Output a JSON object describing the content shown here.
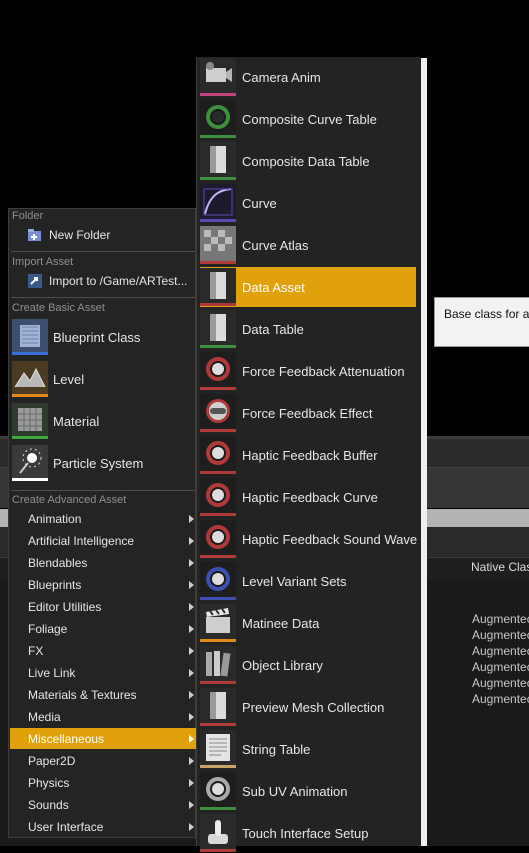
{
  "background": {
    "column_header": "Native Clas",
    "rows": [
      "Augmentec",
      "Augmentec",
      "Augmentec",
      "Augmentec",
      "Augmentec",
      "Augmentec"
    ],
    "tooltip": "Base class for a"
  },
  "left_menu": {
    "sections": {
      "folder": "Folder",
      "import": "Import Asset",
      "basic": "Create Basic Asset",
      "advanced": "Create Advanced Asset"
    },
    "new_folder": "New Folder",
    "import_to": "Import to /Game/ARTest...",
    "basic_assets": [
      {
        "label": "Blueprint Class",
        "icon": "blueprint-class-icon",
        "color": "#3b6fd6"
      },
      {
        "label": "Level",
        "icon": "level-icon",
        "color": "#e08a1e"
      },
      {
        "label": "Material",
        "icon": "material-icon",
        "color": "#3da93d"
      },
      {
        "label": "Particle System",
        "icon": "particle-system-icon",
        "color": "#ffffff"
      }
    ],
    "advanced_items": [
      "Animation",
      "Artificial Intelligence",
      "Blendables",
      "Blueprints",
      "Editor Utilities",
      "Foliage",
      "FX",
      "Live Link",
      "Materials & Textures",
      "Media",
      "Miscellaneous",
      "Paper2D",
      "Physics",
      "Sounds",
      "User Interface"
    ],
    "active_item": "Miscellaneous",
    "accent_color": "#e0a10b"
  },
  "submenu": {
    "items": [
      {
        "label": "Camera Anim",
        "icon": "camera-anim-icon",
        "color": "#c0447e"
      },
      {
        "label": "Composite Curve Table",
        "icon": "composite-curve-table-icon",
        "color": "#3d8f3d"
      },
      {
        "label": "Composite Data Table",
        "icon": "composite-data-table-icon",
        "color": "#3d8f3d"
      },
      {
        "label": "Curve",
        "icon": "curve-icon",
        "color": "#5b4bb0"
      },
      {
        "label": "Curve Atlas",
        "icon": "curve-atlas-icon",
        "color": "#b03a3a"
      },
      {
        "label": "Data Asset",
        "icon": "data-asset-icon",
        "color": "#b03a3a"
      },
      {
        "label": "Data Table",
        "icon": "data-table-icon",
        "color": "#3d8f3d"
      },
      {
        "label": "Force Feedback Attenuation",
        "icon": "force-feedback-attenuation-icon",
        "color": "#b03a3a"
      },
      {
        "label": "Force Feedback Effect",
        "icon": "force-feedback-effect-icon",
        "color": "#b03a3a"
      },
      {
        "label": "Haptic Feedback Buffer",
        "icon": "haptic-feedback-buffer-icon",
        "color": "#b03a3a"
      },
      {
        "label": "Haptic Feedback Curve",
        "icon": "haptic-feedback-curve-icon",
        "color": "#b03a3a"
      },
      {
        "label": "Haptic Feedback Sound Wave",
        "icon": "haptic-feedback-sound-wave-icon",
        "color": "#b03a3a"
      },
      {
        "label": "Level Variant Sets",
        "icon": "level-variant-sets-icon",
        "color": "#3f4fb0"
      },
      {
        "label": "Matinee Data",
        "icon": "matinee-data-icon",
        "color": "#e08a1e"
      },
      {
        "label": "Object Library",
        "icon": "object-library-icon",
        "color": "#b03a3a"
      },
      {
        "label": "Preview Mesh Collection",
        "icon": "preview-mesh-collection-icon",
        "color": "#b03a3a"
      },
      {
        "label": "String Table",
        "icon": "string-table-icon",
        "color": "#c9a46a"
      },
      {
        "label": "Sub UV Animation",
        "icon": "sub-uv-animation-icon",
        "color": "#3d8f3d"
      },
      {
        "label": "Touch Interface Setup",
        "icon": "touch-interface-setup-icon",
        "color": "#b03a3a"
      }
    ],
    "active_item": "Data Asset"
  }
}
